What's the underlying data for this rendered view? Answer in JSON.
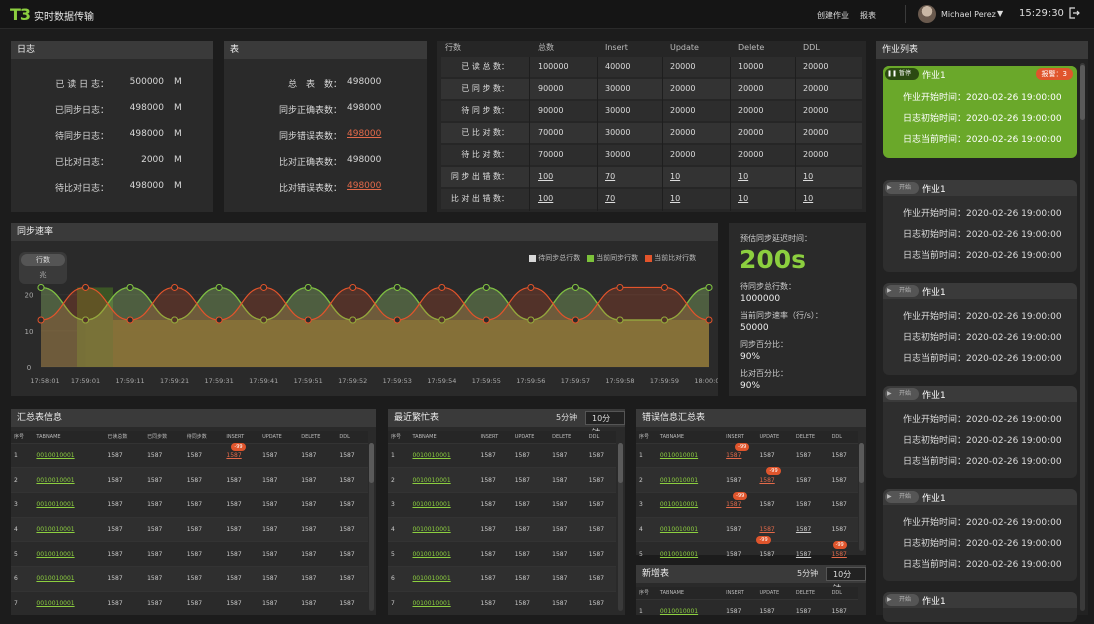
{
  "app": {
    "logo": "T3",
    "title": "实时数据传输"
  },
  "topbar": {
    "create_job": "创建作业",
    "report": "报表",
    "user": "Michael Perez",
    "time": "15:29:30"
  },
  "log_panel": {
    "title": "日志",
    "rows": [
      {
        "label": "已 读 日 志：",
        "value": "500000",
        "unit": "M"
      },
      {
        "label": "已同步日志：",
        "value": "498000",
        "unit": "M"
      },
      {
        "label": "待同步日志：",
        "value": "498000",
        "unit": "M"
      },
      {
        "label": "已比对日志：",
        "value": "2000",
        "unit": "M"
      },
      {
        "label": "待比对日志：",
        "value": "498000",
        "unit": "M"
      }
    ]
  },
  "table_panel": {
    "title": "表",
    "rows": [
      {
        "label": "总　表　数：",
        "value": "498000",
        "link": false
      },
      {
        "label": "同步正确表数：",
        "value": "498000",
        "link": false
      },
      {
        "label": "同步错误表数：",
        "value": "498000",
        "link": true
      },
      {
        "label": "比对正确表数：",
        "value": "498000",
        "link": false
      },
      {
        "label": "比对错误表数：",
        "value": "498000",
        "link": true
      }
    ]
  },
  "stats_panel": {
    "headers": [
      "行数",
      "总数",
      "Insert",
      "Update",
      "Delete",
      "DDL"
    ],
    "rows": [
      {
        "label": "已 读 总 数：",
        "cells": [
          "100000",
          "40000",
          "20000",
          "10000",
          "20000"
        ],
        "link": false
      },
      {
        "label": "已 同 步 数：",
        "cells": [
          "90000",
          "30000",
          "20000",
          "20000",
          "20000"
        ],
        "link": false
      },
      {
        "label": "待 同 步 数：",
        "cells": [
          "90000",
          "30000",
          "20000",
          "20000",
          "20000"
        ],
        "link": false
      },
      {
        "label": "已 比 对 数：",
        "cells": [
          "70000",
          "30000",
          "20000",
          "20000",
          "20000"
        ],
        "link": false
      },
      {
        "label": "待 比 对 数：",
        "cells": [
          "70000",
          "30000",
          "20000",
          "20000",
          "20000"
        ],
        "link": false
      },
      {
        "label": "同 步 出 错 数：",
        "cells": [
          "100",
          "70",
          "10",
          "10",
          "10"
        ],
        "link": true
      },
      {
        "label": "比 对 出 错 数：",
        "cells": [
          "100",
          "70",
          "10",
          "10",
          "10"
        ],
        "link": true
      }
    ]
  },
  "sync_speed": {
    "title": "同步速率",
    "toggle": [
      "行数",
      "兆"
    ],
    "legend": [
      "待同步总行数",
      "当前同步行数",
      "当前比对行数"
    ],
    "colors": {
      "pending": "#9a9a9a",
      "synced": "#7cc23a",
      "compared": "#e3542b"
    }
  },
  "chart_data": {
    "type": "area",
    "x": [
      "17:58:01",
      "17:59:01",
      "17:59:11",
      "17:59:21",
      "17:59:31",
      "17:59:41",
      "17:59:51",
      "17:59:52",
      "17:59:53",
      "17:59:54",
      "17:59:55",
      "17:59:56",
      "17:59:57",
      "17:59:58",
      "17:59:59",
      "18:00:00"
    ],
    "yticks": [
      "0",
      "10",
      "20"
    ],
    "ylim": [
      0,
      26
    ],
    "series": [
      {
        "name": "待同步总行数",
        "color": "#9a9a9a",
        "values": [
          22,
          13,
          22,
          13,
          22,
          13,
          22,
          13,
          22,
          13,
          22,
          13,
          22,
          13,
          13,
          22
        ]
      },
      {
        "name": "当前同步行数",
        "color": "#7cc23a",
        "values": [
          22,
          13,
          22,
          13,
          22,
          13,
          22,
          13,
          22,
          13,
          22,
          13,
          22,
          13,
          13,
          22
        ]
      },
      {
        "name": "当前比对行数",
        "color": "#e3542b",
        "values": [
          13,
          22,
          13,
          22,
          13,
          22,
          13,
          22,
          13,
          22,
          13,
          22,
          13,
          22,
          22,
          13
        ]
      }
    ]
  },
  "delay_panel": {
    "title": "预估同步延迟时间：",
    "value": "200s",
    "items": [
      {
        "label": "待同步总行数：",
        "value": "1000000"
      },
      {
        "label": "当前同步速率（行/s）：",
        "value": "50000"
      },
      {
        "label": "同步百分比：",
        "value": "90%"
      },
      {
        "label": "比对百分比：",
        "value": "90%"
      }
    ]
  },
  "summary_table": {
    "title": "汇总表信息",
    "headers": [
      "序号",
      "TABNAME",
      "已读总数",
      "已同步数",
      "待同步数",
      "INSERT",
      "UPDATE",
      "DELETE",
      "DDL"
    ],
    "rows": [
      [
        "1",
        "0010010001",
        "1587",
        "1587",
        "1587",
        "1587",
        "1587",
        "1587",
        "1587"
      ],
      [
        "2",
        "0010010001",
        "1587",
        "1587",
        "1587",
        "1587",
        "1587",
        "1587",
        "1587"
      ],
      [
        "3",
        "0010010001",
        "1587",
        "1587",
        "1587",
        "1587",
        "1587",
        "1587",
        "1587"
      ],
      [
        "4",
        "0010010001",
        "1587",
        "1587",
        "1587",
        "1587",
        "1587",
        "1587",
        "1587"
      ],
      [
        "5",
        "0010010001",
        "1587",
        "1587",
        "1587",
        "1587",
        "1587",
        "1587",
        "1587"
      ],
      [
        "6",
        "0010010001",
        "1587",
        "1587",
        "1587",
        "1587",
        "1587",
        "1587",
        "1587"
      ],
      [
        "7",
        "0010010001",
        "1587",
        "1587",
        "1587",
        "1587",
        "1587",
        "1587",
        "1587"
      ]
    ],
    "badge": "-99"
  },
  "busy_table": {
    "title": "最近繁忙表",
    "tabs": [
      "5分钟",
      "10分钟"
    ],
    "headers": [
      "序号",
      "TABNAME",
      "INSERT",
      "UPDATE",
      "DELETE",
      "DDL"
    ],
    "rows": [
      [
        "1",
        "0010010001",
        "1587",
        "1587",
        "1587",
        "1587"
      ],
      [
        "2",
        "0010010001",
        "1587",
        "1587",
        "1587",
        "1587"
      ],
      [
        "3",
        "0010010001",
        "1587",
        "1587",
        "1587",
        "1587"
      ],
      [
        "4",
        "0010010001",
        "1587",
        "1587",
        "1587",
        "1587"
      ],
      [
        "5",
        "0010010001",
        "1587",
        "1587",
        "1587",
        "1587"
      ],
      [
        "6",
        "0010010001",
        "1587",
        "1587",
        "1587",
        "1587"
      ],
      [
        "7",
        "0010010001",
        "1587",
        "1587",
        "1587",
        "1587"
      ]
    ]
  },
  "error_table": {
    "title": "错误信息汇总表",
    "headers": [
      "序号",
      "TABNAME",
      "INSERT",
      "UPDATE",
      "DELETE",
      "DDL"
    ],
    "rows": [
      [
        "1",
        "0010010001",
        "1587",
        "1587",
        "1587",
        "1587"
      ],
      [
        "2",
        "0010010001",
        "1587",
        "1587",
        "1587",
        "1587"
      ],
      [
        "3",
        "0010010001",
        "1587",
        "1587",
        "1587",
        "1587"
      ],
      [
        "4",
        "0010010001",
        "1587",
        "1587",
        "1587",
        "1587"
      ],
      [
        "5",
        "0010010001",
        "1587",
        "1587",
        "1587",
        "1587"
      ]
    ],
    "badge": "-99"
  },
  "new_table": {
    "title": "新增表",
    "tabs": [
      "5分钟",
      "10分钟"
    ],
    "headers": [
      "序号",
      "TABNAME",
      "INSERT",
      "UPDATE",
      "DELETE",
      "DDL"
    ],
    "rows": [
      [
        "1",
        "0010010001",
        "1587",
        "1587",
        "1587",
        "1587"
      ]
    ]
  },
  "job_list": {
    "title": "作业列表",
    "jobs": [
      {
        "status": "暂停",
        "name": "作业1",
        "alarm": "报警：3",
        "lines": [
          "作业开始时间：2020-02-26 19:00:00",
          "日志初始时间：2020-02-26 19:00:00",
          "日志当前时间：2020-02-26 19:00:00"
        ]
      },
      {
        "status": "开始",
        "name": "作业1",
        "lines": [
          "作业开始时间：2020-02-26 19:00:00",
          "日志初始时间：2020-02-26 19:00:00",
          "日志当前时间：2020-02-26 19:00:00"
        ]
      },
      {
        "status": "开始",
        "name": "作业1",
        "lines": [
          "作业开始时间：2020-02-26 19:00:00",
          "日志初始时间：2020-02-26 19:00:00",
          "日志当前时间：2020-02-26 19:00:00"
        ]
      },
      {
        "status": "开始",
        "name": "作业1",
        "lines": [
          "作业开始时间：2020-02-26 19:00:00",
          "日志初始时间：2020-02-26 19:00:00",
          "日志当前时间：2020-02-26 19:00:00"
        ]
      },
      {
        "status": "开始",
        "name": "作业1",
        "lines": [
          "作业开始时间：2020-02-26 19:00:00",
          "日志初始时间：2020-02-26 19:00:00",
          "日志当前时间：2020-02-26 19:00:00"
        ]
      },
      {
        "status": "开始",
        "name": "作业1"
      }
    ]
  }
}
